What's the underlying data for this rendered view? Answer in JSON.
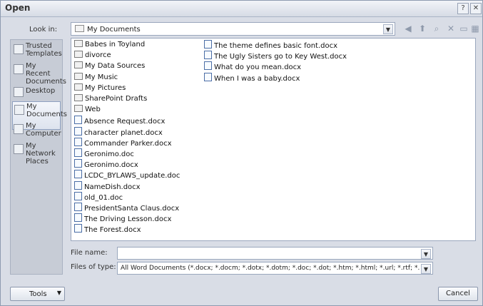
{
  "window": {
    "title": "Open"
  },
  "look_in": {
    "label": "Look in:",
    "value": "My Documents"
  },
  "places": [
    {
      "label": "Trusted Templates"
    },
    {
      "label": "My Recent Documents"
    },
    {
      "label": "Desktop"
    },
    {
      "label": "My Documents"
    },
    {
      "label": "My Computer"
    },
    {
      "label": "My Network Places"
    }
  ],
  "files_col1": [
    {
      "name": "Babes in Toyland",
      "type": "folder"
    },
    {
      "name": "divorce",
      "type": "folder"
    },
    {
      "name": "My Data Sources",
      "type": "folder"
    },
    {
      "name": "My Music",
      "type": "folder"
    },
    {
      "name": "My Pictures",
      "type": "folder"
    },
    {
      "name": "SharePoint Drafts",
      "type": "folder"
    },
    {
      "name": "Web",
      "type": "folder"
    },
    {
      "name": "Absence Request.docx",
      "type": "doc"
    },
    {
      "name": "character planet.docx",
      "type": "doc"
    },
    {
      "name": "Commander Parker.docx",
      "type": "doc"
    },
    {
      "name": "Geronimo.doc",
      "type": "doc"
    },
    {
      "name": "Geronimo.docx",
      "type": "doc"
    },
    {
      "name": "LCDC_BYLAWS_update.doc",
      "type": "doc"
    },
    {
      "name": "NameDish.docx",
      "type": "doc"
    },
    {
      "name": "old_01.doc",
      "type": "doc"
    },
    {
      "name": "PresidentSanta Claus.docx",
      "type": "doc"
    },
    {
      "name": "The Driving Lesson.docx",
      "type": "doc"
    },
    {
      "name": "The Forest.docx",
      "type": "doc"
    }
  ],
  "files_col2": [
    {
      "name": "The theme defines basic font.docx",
      "type": "doc"
    },
    {
      "name": "The Ugly Sisters go to Key West.docx",
      "type": "doc"
    },
    {
      "name": "What do you mean.docx",
      "type": "doc"
    },
    {
      "name": "When I was a baby.docx",
      "type": "doc"
    }
  ],
  "file_name": {
    "label": "File name:",
    "value": ""
  },
  "files_of_type": {
    "label": "Files of type:",
    "value": "All Word Documents (*.docx; *.docm; *.dotx; *.dotm; *.doc; *.dot; *.htm; *.html; *.url; *.rtf; *.mh"
  },
  "buttons": {
    "tools": "Tools",
    "cancel": "Cancel"
  }
}
